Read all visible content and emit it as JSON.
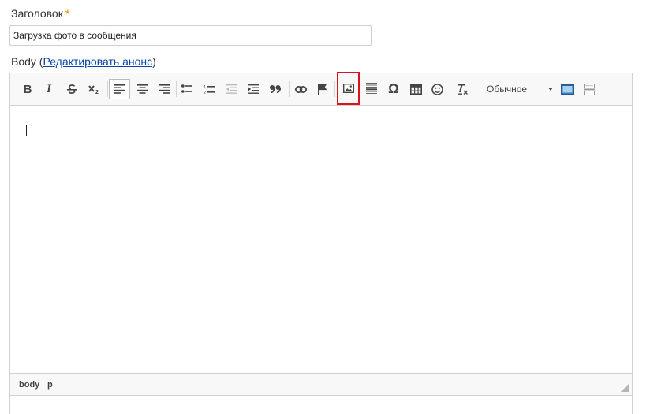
{
  "form": {
    "title_label": "Заголовок",
    "required_mark": "*",
    "title_value": "Загрузка фото в сообщения",
    "body_label_prefix": "Body (",
    "body_edit_link": "Редактировать анонс",
    "body_label_suffix": ")"
  },
  "toolbar": {
    "bold": "B",
    "italic": "I",
    "special_char": "Ω",
    "format_value": "Обычное",
    "icons": [
      "bold-icon",
      "italic-icon",
      "strikethrough-icon",
      "subscript-icon",
      "align-left-icon",
      "align-center-icon",
      "align-right-icon",
      "bulleted-list-icon",
      "numbered-list-icon",
      "decrease-indent-icon",
      "increase-indent-icon",
      "blockquote-icon",
      "link-icon",
      "anchor-flag-icon",
      "image-icon",
      "horizontal-line-icon",
      "special-char-icon",
      "table-icon",
      "smiley-icon",
      "remove-format-icon",
      "format-dropdown",
      "maximize-icon",
      "show-blocks-icon"
    ],
    "highlighted": "image-icon",
    "active": "align-left-icon",
    "highlight_color": "#d9141c"
  },
  "statusbar": {
    "path": [
      "body",
      "p"
    ]
  }
}
